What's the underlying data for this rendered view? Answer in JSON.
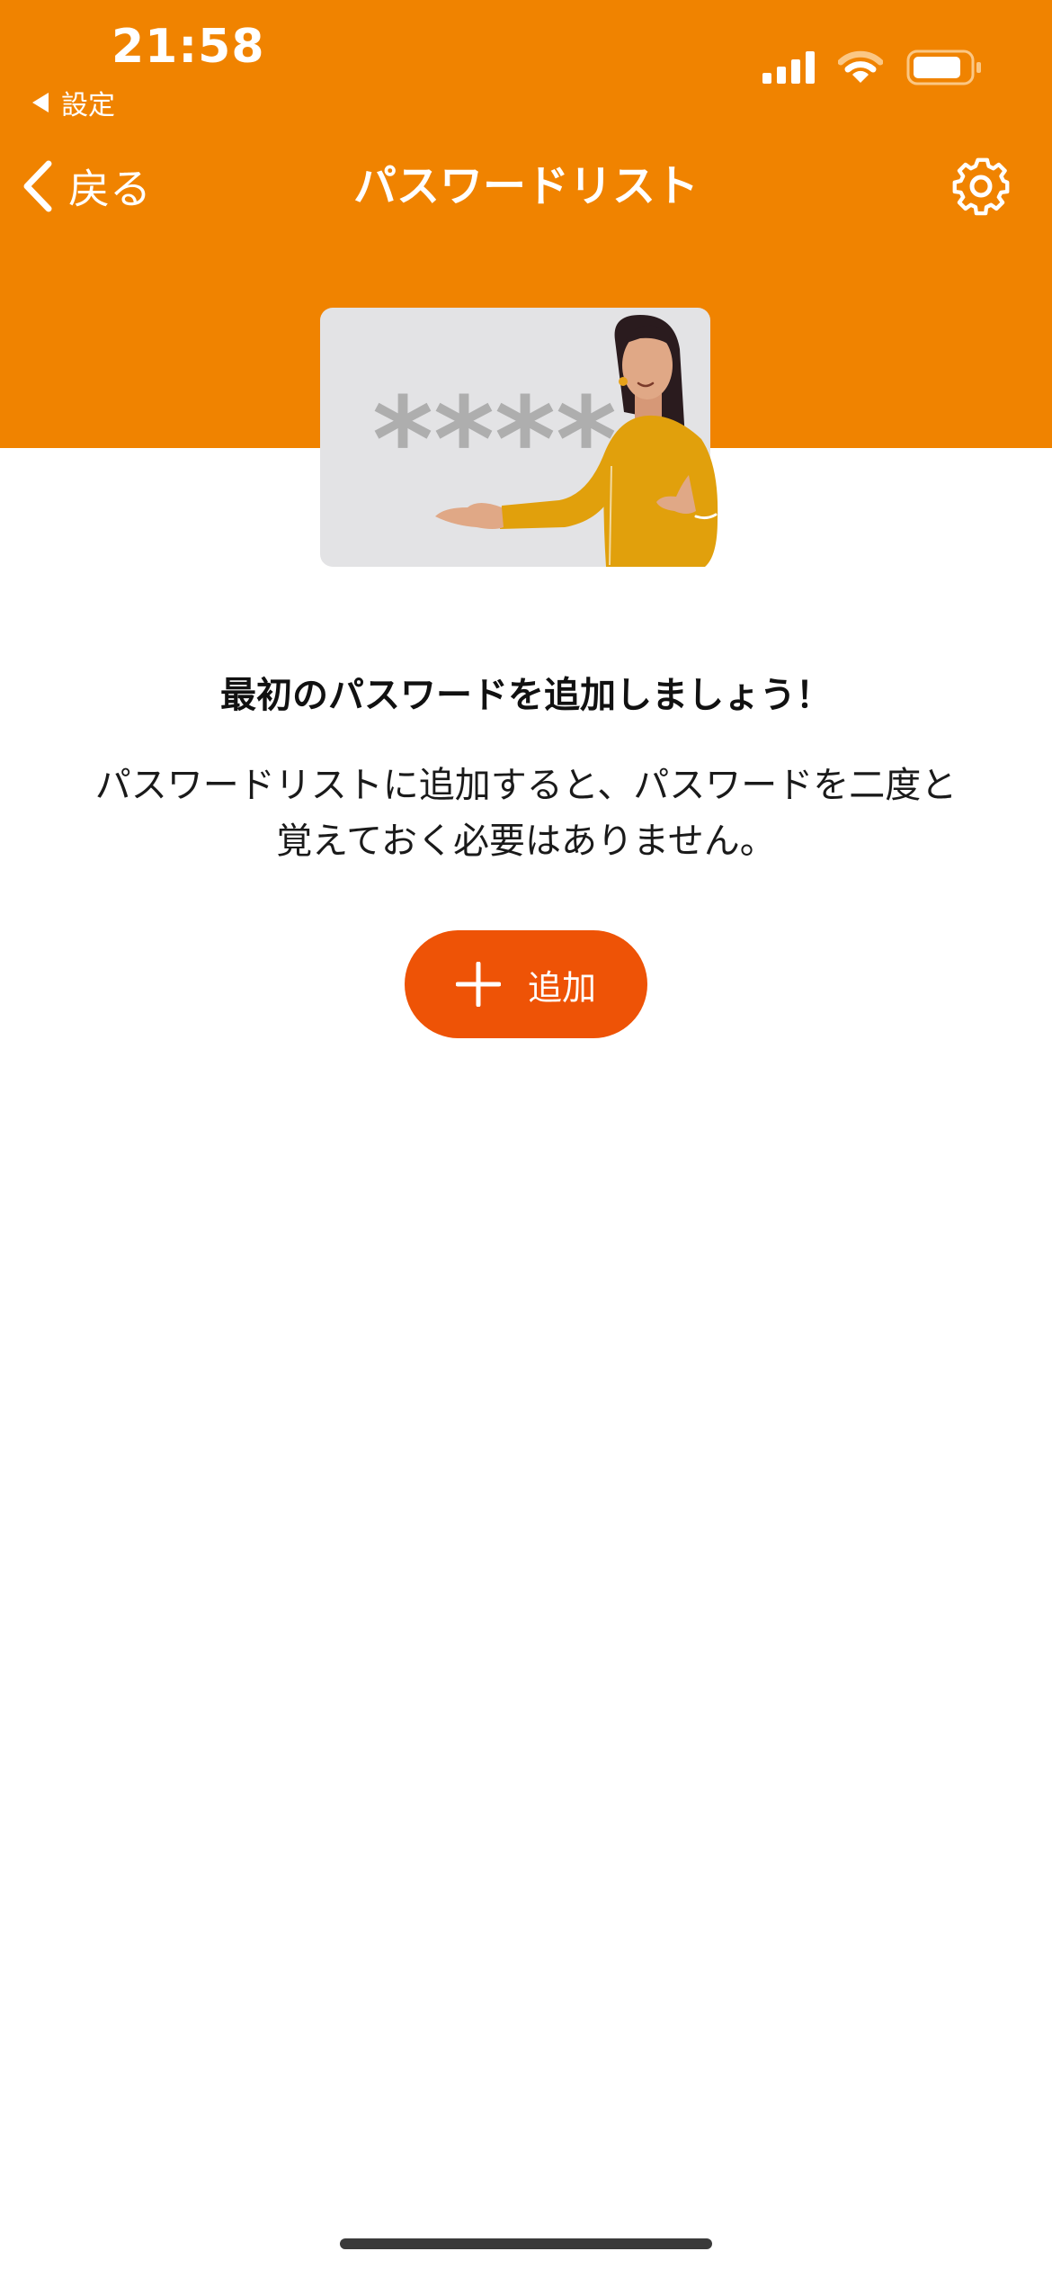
{
  "status_bar": {
    "time": "21:58",
    "back_app_label": "設定"
  },
  "nav": {
    "back_label": "戻る",
    "title": "パスワードリスト"
  },
  "illustration": {
    "masked_text": "****"
  },
  "empty_state": {
    "headline": "最初のパスワードを追加しましょう！",
    "description_line1": "パスワードリストに追加すると、パスワードを二度と",
    "description_line2": "覚えておく必要はありません。",
    "add_button_label": "追加"
  },
  "colors": {
    "header_orange": "#F08300",
    "button_orange": "#EE5306",
    "card_gray": "#E3E3E5",
    "asterisk_gray": "#AEAEAE",
    "sweater_yellow": "#E1A00C"
  },
  "icons": [
    "back-triangle-icon",
    "cellular-signal-icon",
    "wifi-icon",
    "battery-icon",
    "chevron-left-icon",
    "gear-icon",
    "plus-icon"
  ]
}
